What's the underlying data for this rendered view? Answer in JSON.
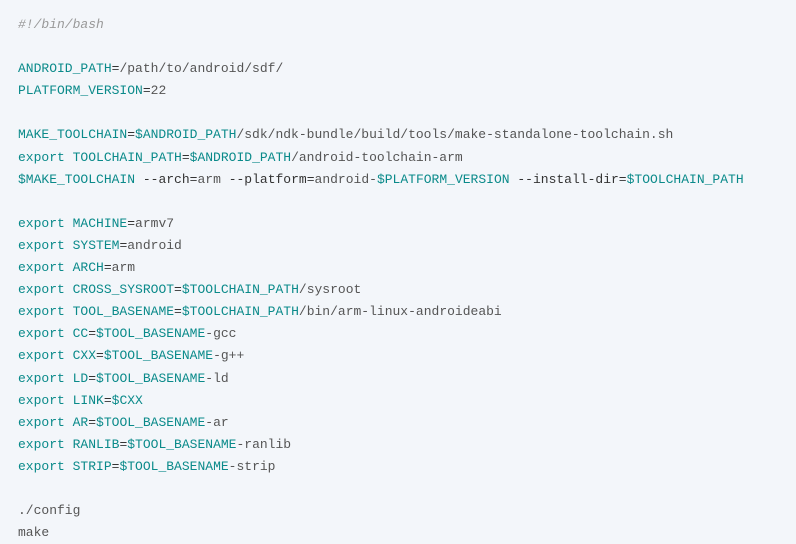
{
  "code": {
    "shebang": "#!/bin/bash",
    "android_path_var": "ANDROID_PATH",
    "android_path_val": "/path/to/android/sdf/",
    "platform_version_var": "PLATFORM_VERSION",
    "platform_version_val": "22",
    "make_toolchain_var": "MAKE_TOOLCHAIN",
    "make_toolchain_ref": "$ANDROID_PATH",
    "make_toolchain_path": "/sdk/ndk-bundle/build/tools/make-standalone-toolchain.sh",
    "export_kw": "export",
    "toolchain_path_var": "TOOLCHAIN_PATH",
    "toolchain_path_ref": "$ANDROID_PATH",
    "toolchain_path_val": "/android-toolchain-arm",
    "invoke_make": "$MAKE_TOOLCHAIN",
    "arch_flag": "--arch",
    "arch_val": "arm ",
    "platform_flag": "--platform",
    "platform_prefix": "android-",
    "platform_ref": "$PLATFORM_VERSION",
    "install_flag": "--install-dir",
    "install_ref": "$TOOLCHAIN_PATH",
    "machine_var": "MACHINE",
    "machine_val": "armv7",
    "system_var": "SYSTEM",
    "system_val": "android",
    "arch_var": "ARCH",
    "arch_val2": "arm",
    "cross_var": "CROSS_SYSROOT",
    "cross_ref": "$TOOLCHAIN_PATH",
    "cross_path": "/sysroot",
    "toolbase_var": "TOOL_BASENAME",
    "toolbase_ref": "$TOOLCHAIN_PATH",
    "toolbase_path": "/bin/arm-linux-androideabi",
    "cc_var": "CC",
    "cc_ref": "$TOOL_BASENAME",
    "cc_suf": "-gcc",
    "cxx_var": "CXX",
    "cxx_ref": "$TOOL_BASENAME",
    "cxx_suf": "-g++",
    "ld_var": "LD",
    "ld_ref": "$TOOL_BASENAME",
    "ld_suf": "-ld",
    "link_var": "LINK",
    "link_ref": "$CXX",
    "ar_var": "AR",
    "ar_ref": "$TOOL_BASENAME",
    "ar_suf": "-ar",
    "ranlib_var": "RANLIB",
    "ranlib_ref": "$TOOL_BASENAME",
    "ranlib_suf": "-ranlib",
    "strip_var": "STRIP",
    "strip_ref": "$TOOL_BASENAME",
    "strip_suf": "-strip",
    "config_cmd": "./config",
    "make_cmd": "make",
    "eq": "="
  }
}
